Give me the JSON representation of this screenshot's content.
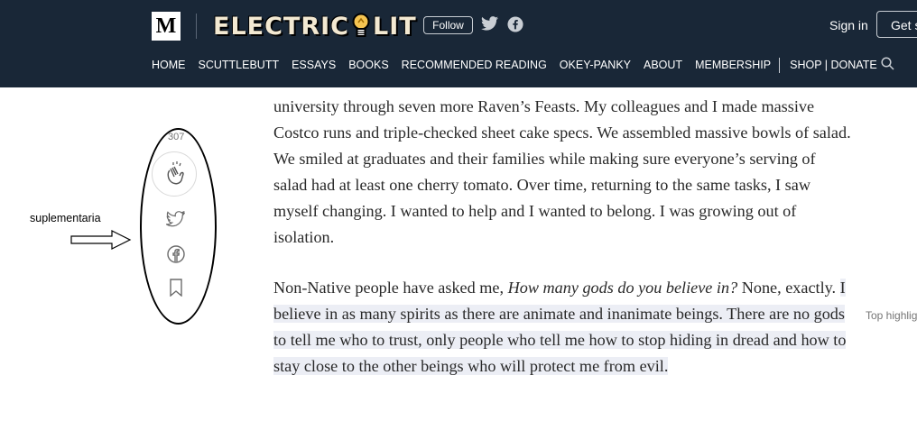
{
  "header": {
    "m_logo": "M",
    "brand_left": "ELECTRIC",
    "brand_right": "LIT",
    "follow_label": "Follow",
    "sign_in_label": "Sign in",
    "get_started_label": "Get s",
    "nav": [
      "HOME",
      "SCUTTLEBUTT",
      "ESSAYS",
      "BOOKS",
      "RECOMMENDED READING",
      "OKEY-PANKY",
      "ABOUT",
      "MEMBERSHIP",
      "SHOP | DONATE"
    ],
    "icons": [
      "twitter-icon",
      "facebook-icon",
      "search-icon",
      "lightbulb-icon"
    ]
  },
  "colors": {
    "header_bg": "#192737",
    "highlight_bg": "#eceef5",
    "text": "#292929"
  },
  "sidebar": {
    "clap_count": "307",
    "icons": [
      "clap-icon",
      "twitter-icon",
      "facebook-icon",
      "bookmark-icon"
    ]
  },
  "annotation": {
    "label": "suplementaria"
  },
  "article": {
    "p1": "university through seven more Raven’s Feasts. My colleagues and I made massive Costco runs and triple-checked sheet cake specs. We assembled massive bowls of salad. We smiled at graduates and their families while making sure everyone’s serving of salad had at least one cherry tomato. Over time, returning to the same tasks, I saw myself changing. I wanted to help and I wanted to belong. I was growing out of isolation.",
    "p2_start": "Non-Native people have asked me, ",
    "p2_question": "How many gods do you believe in?",
    "p2_mid": " None, exactly. ",
    "p2_highlight": "I believe in as many spirits as there are animate and inanimate beings. There are no gods to tell me who to trust, only people who tell me how to stop hiding in dread and how to stay close to the other beings who will protect me from evil."
  },
  "top_highlight_label": "Top highlig"
}
